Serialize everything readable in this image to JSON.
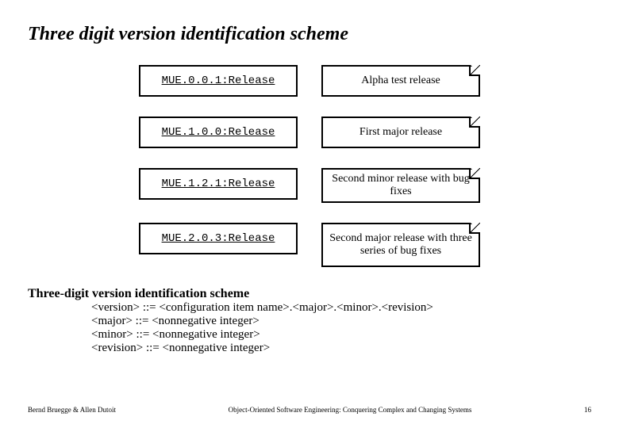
{
  "title": "Three digit version identification scheme",
  "rows": [
    {
      "label": "MUE.0.0.1:Release",
      "note": "Alpha test release"
    },
    {
      "label": "MUE.1.0.0:Release",
      "note": "First major release"
    },
    {
      "label": "MUE.1.2.1:Release",
      "note": "Second minor release with bug fixes"
    },
    {
      "label": "MUE.2.0.3:Release",
      "note": "Second major release with three series of bug fixes"
    }
  ],
  "scheme": {
    "heading": "Three-digit version identification scheme",
    "lines": [
      "<version> ::= <configuration item name>.<major>.<minor>.<revision>",
      "<major> ::= <nonnegative integer>",
      "<minor> ::= <nonnegative integer>",
      "<revision> ::= <nonnegative integer>"
    ]
  },
  "footer": {
    "left": "Bernd Bruegge & Allen Dutoit",
    "center": "Object-Oriented Software Engineering: Conquering Complex and Changing Systems",
    "right": "16"
  }
}
